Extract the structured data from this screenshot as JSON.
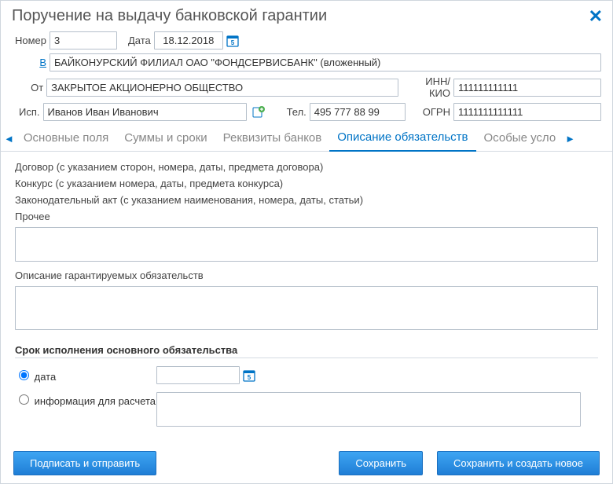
{
  "title": "Поручение на выдачу банковской гарантии",
  "header": {
    "number_label": "Номер",
    "number_value": "3",
    "date_label": "Дата",
    "date_value": "18.12.2018",
    "in_label": "В",
    "in_value": "БАЙКОНУРСКИЙ ФИЛИАЛ ОАО \"ФОНДСЕРВИСБАНК\" (вложенный)",
    "from_label": "От",
    "from_value": "ЗАКРЫТОЕ АКЦИОНЕРНО ОБЩЕСТВО",
    "inn_label": "ИНН/КИО",
    "inn_value": "111111111111",
    "isp_label": "Исп.",
    "isp_value": "Иванов Иван Иванович",
    "tel_label": "Тел.",
    "tel_value": "495 777 88 99",
    "ogrn_label": "ОГРН",
    "ogrn_value": "1111111111111"
  },
  "tabs": {
    "t1": "Основные поля",
    "t2": "Суммы и сроки",
    "t3": "Реквизиты банков",
    "t4": "Описание обязательств",
    "t5": "Особые усло"
  },
  "content": {
    "line1": "Договор (с указанием сторон, номера, даты, предмета договора)",
    "line2": "Конкурс (с указанием номера, даты, предмета конкурса)",
    "line3": "Законодательный акт (с указанием наименования, номера, даты, статьи)",
    "other_label": "Прочее",
    "desc_label": "Описание гарантируемых обязательств",
    "deadline_head": "Срок исполнения основного обязательства",
    "radio_date": "дата",
    "radio_calc": "информация для расчета"
  },
  "buttons": {
    "sign_send": "Подписать и отправить",
    "save": "Сохранить",
    "save_new": "Сохранить и создать новое"
  }
}
